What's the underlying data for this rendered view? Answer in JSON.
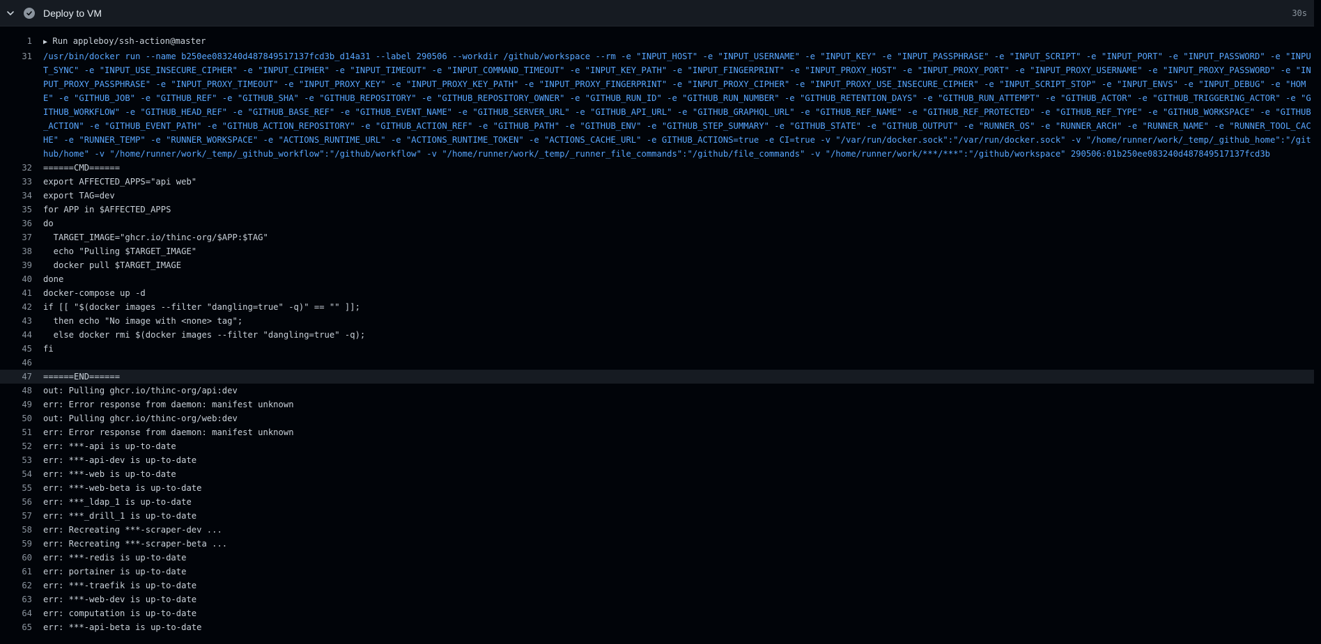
{
  "step": {
    "title": "Deploy to VM",
    "duration": "30s",
    "status": "success"
  },
  "colors": {
    "background": "#010409",
    "header_bg": "#161b22",
    "command_text": "#58a6ff",
    "line_number": "#8b949e",
    "text": "#c9d1d9"
  },
  "log": {
    "group": {
      "number": "1",
      "label": "Run appleboy/ssh-action@master",
      "expanded": false
    },
    "docker_cmd": {
      "number": "31",
      "text": "/usr/bin/docker run --name b250ee083240d487849517137fcd3b_d14a31 --label 290506 --workdir /github/workspace --rm -e \"INPUT_HOST\" -e \"INPUT_USERNAME\" -e \"INPUT_KEY\" -e \"INPUT_PASSPHRASE\" -e \"INPUT_SCRIPT\" -e \"INPUT_PORT\" -e \"INPUT_PASSWORD\" -e \"INPUT_SYNC\" -e \"INPUT_USE_INSECURE_CIPHER\" -e \"INPUT_CIPHER\" -e \"INPUT_TIMEOUT\" -e \"INPUT_COMMAND_TIMEOUT\" -e \"INPUT_KEY_PATH\" -e \"INPUT_FINGERPRINT\" -e \"INPUT_PROXY_HOST\" -e \"INPUT_PROXY_PORT\" -e \"INPUT_PROXY_USERNAME\" -e \"INPUT_PROXY_PASSWORD\" -e \"INPUT_PROXY_PASSPHRASE\" -e \"INPUT_PROXY_TIMEOUT\" -e \"INPUT_PROXY_KEY\" -e \"INPUT_PROXY_KEY_PATH\" -e \"INPUT_PROXY_FINGERPRINT\" -e \"INPUT_PROXY_CIPHER\" -e \"INPUT_PROXY_USE_INSECURE_CIPHER\" -e \"INPUT_SCRIPT_STOP\" -e \"INPUT_ENVS\" -e \"INPUT_DEBUG\" -e \"HOME\" -e \"GITHUB_JOB\" -e \"GITHUB_REF\" -e \"GITHUB_SHA\" -e \"GITHUB_REPOSITORY\" -e \"GITHUB_REPOSITORY_OWNER\" -e \"GITHUB_RUN_ID\" -e \"GITHUB_RUN_NUMBER\" -e \"GITHUB_RETENTION_DAYS\" -e \"GITHUB_RUN_ATTEMPT\" -e \"GITHUB_ACTOR\" -e \"GITHUB_TRIGGERING_ACTOR\" -e \"GITHUB_WORKFLOW\" -e \"GITHUB_HEAD_REF\" -e \"GITHUB_BASE_REF\" -e \"GITHUB_EVENT_NAME\" -e \"GITHUB_SERVER_URL\" -e \"GITHUB_API_URL\" -e \"GITHUB_GRAPHQL_URL\" -e \"GITHUB_REF_NAME\" -e \"GITHUB_REF_PROTECTED\" -e \"GITHUB_REF_TYPE\" -e \"GITHUB_WORKSPACE\" -e \"GITHUB_ACTION\" -e \"GITHUB_EVENT_PATH\" -e \"GITHUB_ACTION_REPOSITORY\" -e \"GITHUB_ACTION_REF\" -e \"GITHUB_PATH\" -e \"GITHUB_ENV\" -e \"GITHUB_STEP_SUMMARY\" -e \"GITHUB_STATE\" -e \"GITHUB_OUTPUT\" -e \"RUNNER_OS\" -e \"RUNNER_ARCH\" -e \"RUNNER_NAME\" -e \"RUNNER_TOOL_CACHE\" -e \"RUNNER_TEMP\" -e \"RUNNER_WORKSPACE\" -e \"ACTIONS_RUNTIME_URL\" -e \"ACTIONS_RUNTIME_TOKEN\" -e \"ACTIONS_CACHE_URL\" -e GITHUB_ACTIONS=true -e CI=true -v \"/var/run/docker.sock\":\"/var/run/docker.sock\" -v \"/home/runner/work/_temp/_github_home\":\"/github/home\" -v \"/home/runner/work/_temp/_github_workflow\":\"/github/workflow\" -v \"/home/runner/work/_temp/_runner_file_commands\":\"/github/file_commands\" -v \"/home/runner/work/***/***\":\"/github/workspace\" 290506:01b250ee083240d487849517137fcd3b"
    },
    "lines": [
      {
        "number": "32",
        "text": "======CMD======"
      },
      {
        "number": "33",
        "text": "export AFFECTED_APPS=\"api web\""
      },
      {
        "number": "34",
        "text": "export TAG=dev"
      },
      {
        "number": "35",
        "text": "for APP in $AFFECTED_APPS"
      },
      {
        "number": "36",
        "text": "do"
      },
      {
        "number": "37",
        "text": "  TARGET_IMAGE=\"ghcr.io/thinc-org/$APP:$TAG\""
      },
      {
        "number": "38",
        "text": "  echo \"Pulling $TARGET_IMAGE\""
      },
      {
        "number": "39",
        "text": "  docker pull $TARGET_IMAGE"
      },
      {
        "number": "40",
        "text": "done"
      },
      {
        "number": "41",
        "text": "docker-compose up -d"
      },
      {
        "number": "42",
        "text": "if [[ \"$(docker images --filter \"dangling=true\" -q)\" == \"\" ]];"
      },
      {
        "number": "43",
        "text": "  then echo \"No image with <none> tag\";"
      },
      {
        "number": "44",
        "text": "  else docker rmi $(docker images --filter \"dangling=true\" -q);"
      },
      {
        "number": "45",
        "text": "fi"
      },
      {
        "number": "46",
        "text": ""
      },
      {
        "number": "47",
        "text": "======END======"
      },
      {
        "number": "48",
        "text": "out: Pulling ghcr.io/thinc-org/api:dev"
      },
      {
        "number": "49",
        "text": "err: Error response from daemon: manifest unknown"
      },
      {
        "number": "50",
        "text": "out: Pulling ghcr.io/thinc-org/web:dev"
      },
      {
        "number": "51",
        "text": "err: Error response from daemon: manifest unknown"
      },
      {
        "number": "52",
        "text": "err: ***-api is up-to-date"
      },
      {
        "number": "53",
        "text": "err: ***-api-dev is up-to-date"
      },
      {
        "number": "54",
        "text": "err: ***-web is up-to-date"
      },
      {
        "number": "55",
        "text": "err: ***-web-beta is up-to-date"
      },
      {
        "number": "56",
        "text": "err: ***_ldap_1 is up-to-date"
      },
      {
        "number": "57",
        "text": "err: ***_drill_1 is up-to-date"
      },
      {
        "number": "58",
        "text": "err: Recreating ***-scraper-dev ..."
      },
      {
        "number": "59",
        "text": "err: Recreating ***-scraper-beta ..."
      },
      {
        "number": "60",
        "text": "err: ***-redis is up-to-date"
      },
      {
        "number": "61",
        "text": "err: portainer is up-to-date"
      },
      {
        "number": "62",
        "text": "err: ***-traefik is up-to-date"
      },
      {
        "number": "63",
        "text": "err: ***-web-dev is up-to-date"
      },
      {
        "number": "64",
        "text": "err: computation is up-to-date"
      },
      {
        "number": "65",
        "text": "err: ***-api-beta is up-to-date"
      }
    ]
  }
}
